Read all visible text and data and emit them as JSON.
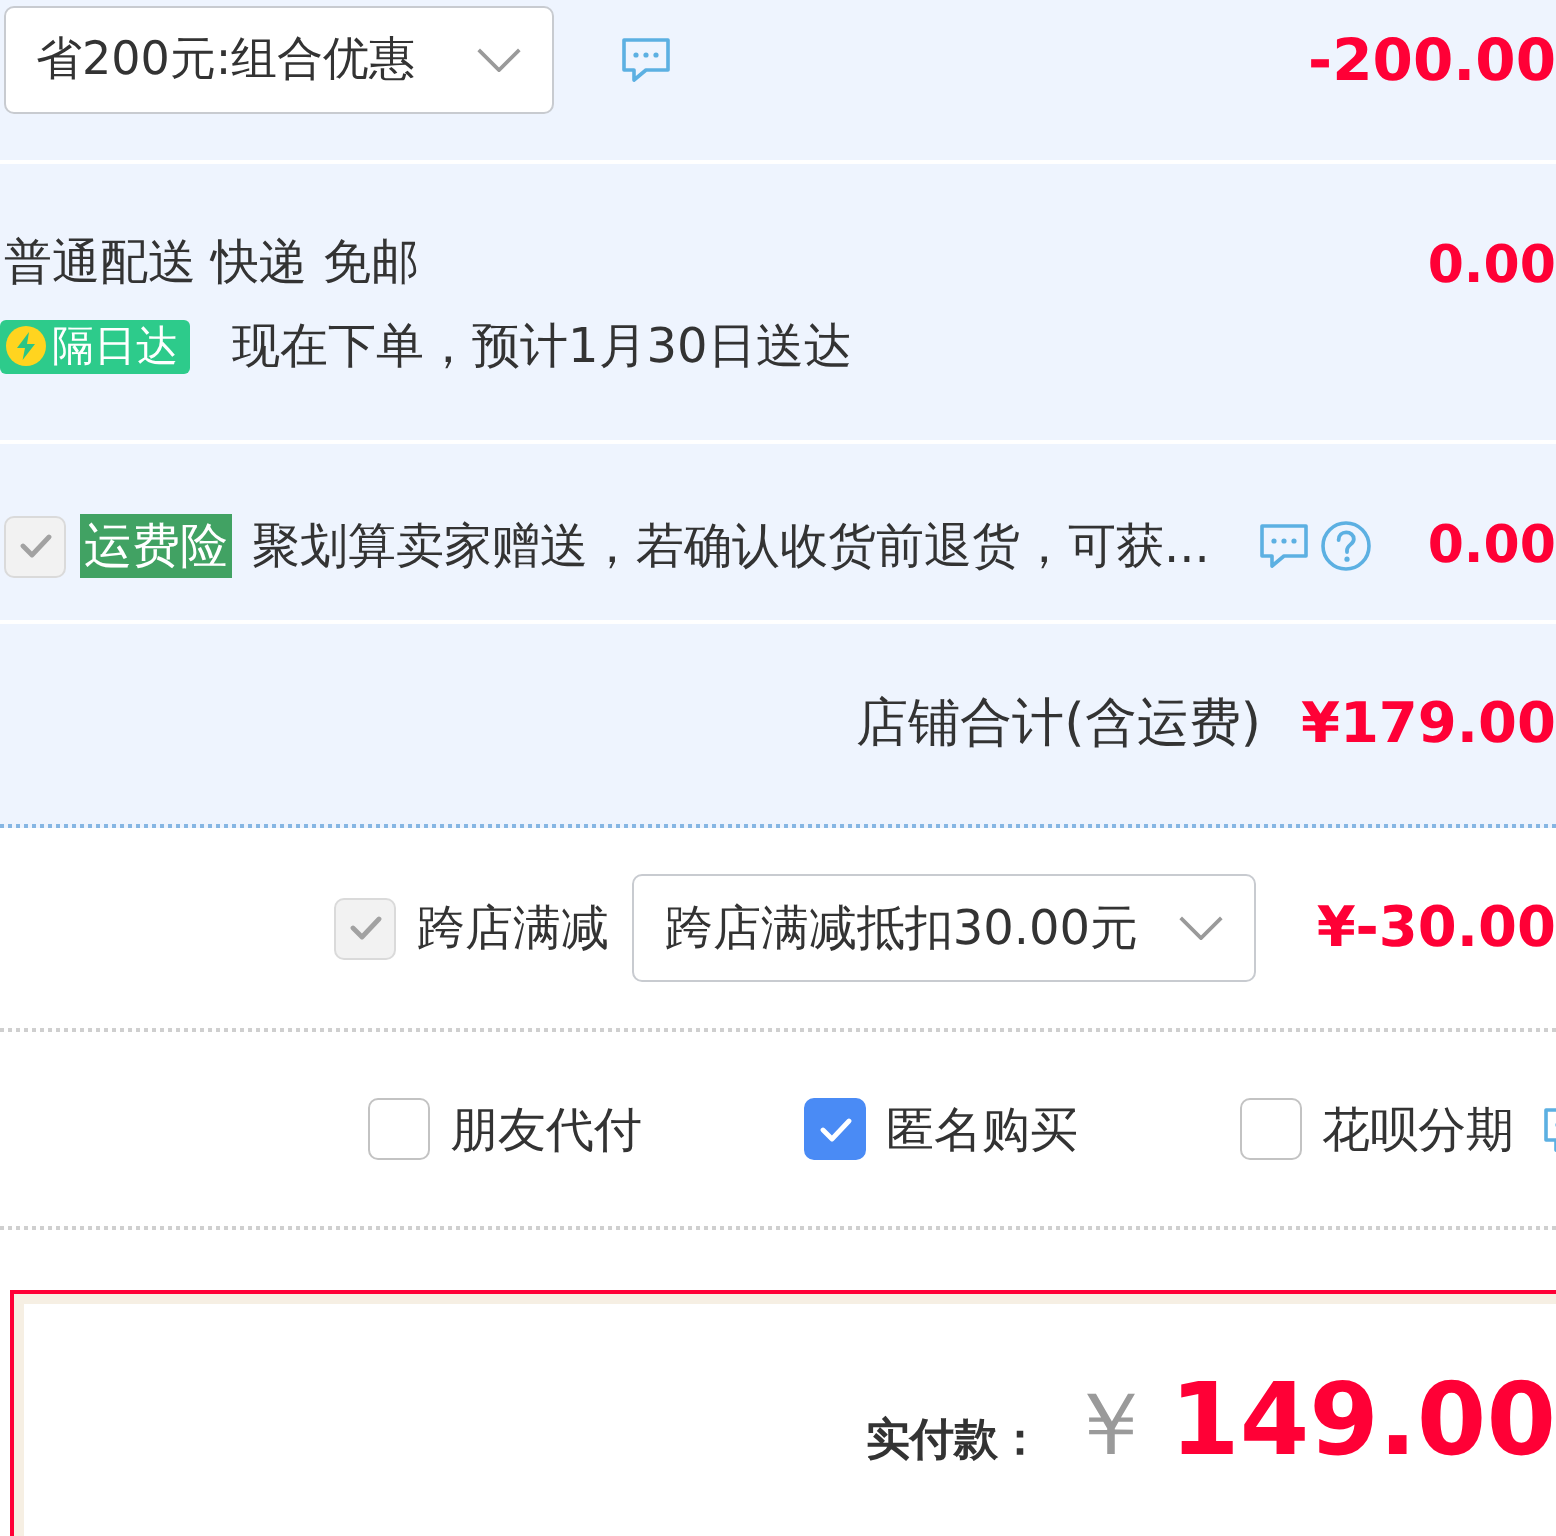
{
  "discount": {
    "dropdown": {
      "value": "省200元:组合优惠"
    },
    "amount": "-200.00"
  },
  "shipping": {
    "method": "普通配送 快递 免邮",
    "amount": "0.00",
    "badge": "隔日达",
    "estimate": "现在下单，预计1月30日送达"
  },
  "shipping_insurance": {
    "checked": true,
    "disabled": true,
    "tag": "运费险",
    "description": "聚划算卖家赠送，若确认收货前退货，可获...",
    "amount": "0.00"
  },
  "shop_total": {
    "label": "店铺合计(含运费)",
    "amount": "¥179.00"
  },
  "cross_store": {
    "checked": true,
    "disabled": true,
    "label": "跨店满减",
    "dropdown": {
      "value": "跨店满减抵扣30.00元"
    },
    "amount": "¥-30.00"
  },
  "options": [
    {
      "label": "朋友代付",
      "checked": false
    },
    {
      "label": "匿名购买",
      "checked": true
    },
    {
      "label": "花呗分期",
      "checked": false
    }
  ],
  "payment": {
    "label": "实付款：",
    "currency": "￥",
    "amount": "149.00"
  }
}
